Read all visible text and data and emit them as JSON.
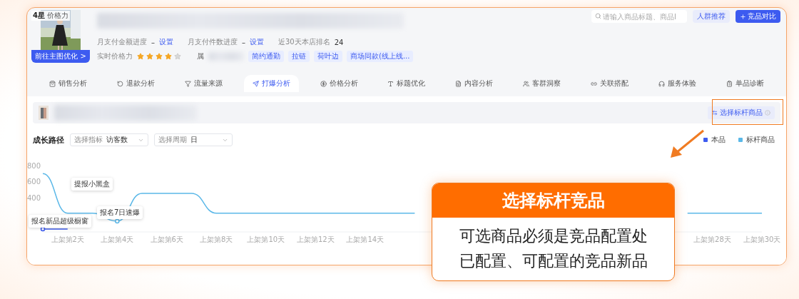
{
  "header": {
    "image_badge": "**4星** 价格力",
    "optimize_button": "前往主图优化 >",
    "stats": [
      {
        "label": "月支付金额进度",
        "value": "–",
        "link": "设置"
      },
      {
        "label": "月支付件数进度",
        "value": "–",
        "link": "设置"
      },
      {
        "label": "近30天本店排名",
        "value": "24"
      }
    ],
    "price_power": {
      "label": "实时价格力",
      "stars": 4
    },
    "attribute_label": "属",
    "tags": [
      "简约通勤",
      "拉链",
      "荷叶边",
      "商场同款(线上线..."
    ]
  },
  "search": {
    "placeholder": "请输入商品标题、商品I"
  },
  "buttons": [
    {
      "label": "人群推荐",
      "kind": "secondary"
    },
    {
      "label": "竞品对比",
      "kind": "primary"
    }
  ],
  "tabs": [
    {
      "label": "销售分析",
      "selected": false
    },
    {
      "label": "退款分析",
      "selected": false
    },
    {
      "label": "流量来源",
      "selected": false
    },
    {
      "label": "打爆分析",
      "selected": true
    },
    {
      "label": "价格分析",
      "selected": false
    },
    {
      "label": "标题优化",
      "selected": false
    },
    {
      "label": "内容分析",
      "selected": false
    },
    {
      "label": "客群洞察",
      "selected": false
    },
    {
      "label": "关联搭配",
      "selected": false
    },
    {
      "label": "服务体验",
      "selected": false
    },
    {
      "label": "单品诊断",
      "selected": false
    }
  ],
  "benchmark": {
    "button": "选择标杆商品"
  },
  "growth": {
    "title": "成长路径",
    "filters": [
      {
        "label": "选择指标",
        "value": "访客数"
      },
      {
        "label": "选择周期",
        "value": "日"
      }
    ],
    "chart_data": {
      "type": "line",
      "categories": [
        null,
        "上架第2天",
        null,
        "上架第4天",
        null,
        "上架第6天",
        null,
        "上架第8天",
        null,
        "上架第10天",
        null,
        "上架第12天",
        null,
        "上架第14天",
        null,
        null,
        null,
        null,
        null,
        null,
        null,
        null,
        null,
        null,
        null,
        null,
        null,
        "上架第28天",
        null,
        "上架第30天"
      ],
      "series": [
        {
          "name": "本品",
          "color": "#3d5bf0",
          "values": [
            0,
            0,
            null,
            null,
            null,
            null,
            null,
            null,
            null,
            null,
            null,
            null,
            null,
            null,
            null,
            null,
            null,
            null,
            null,
            null,
            null,
            null,
            null,
            null,
            null,
            null,
            null,
            null,
            null,
            null
          ]
        },
        {
          "name": "标杆商品",
          "color": "#5bb8e8",
          "values": [
            700,
            200,
            200,
            100,
            450,
            450,
            450,
            200,
            200,
            200,
            200,
            200,
            200,
            200,
            200,
            200,
            null,
            null,
            null,
            null,
            null,
            null,
            null,
            null,
            null,
            null,
            200,
            200,
            200,
            200
          ]
        }
      ],
      "ylim": [
        0,
        800
      ],
      "yticks": [
        400,
        600,
        800
      ],
      "annotations": [
        "提报小黑盒",
        "报名新品超级橱窗",
        "报名7日速爆"
      ]
    }
  },
  "callout": {
    "title": "选择标杆竞品",
    "body": "可选商品必须是竞品配置处已配置、可配置的竞品新品"
  }
}
